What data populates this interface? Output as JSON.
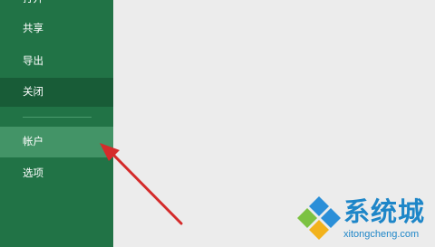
{
  "sidebar": {
    "items": [
      {
        "label": "打开",
        "state": "normal"
      },
      {
        "label": "共享",
        "state": "normal"
      },
      {
        "label": "导出",
        "state": "normal"
      },
      {
        "label": "关闭",
        "state": "selected"
      },
      {
        "label": "帐户",
        "state": "hover"
      },
      {
        "label": "选项",
        "state": "normal"
      }
    ]
  },
  "watermark": {
    "title": "系统城",
    "domain": "xitongcheng.com"
  },
  "colors": {
    "sidebar_bg": "#217346",
    "selected_bg": "#185c37",
    "hover_bg": "#439467",
    "content_bg": "#ececec",
    "arrow": "#d42b2b",
    "watermark_blue": "#1e86c8"
  },
  "icons": [
    "red-arrow-annotation",
    "watermark-diamond-logo"
  ]
}
